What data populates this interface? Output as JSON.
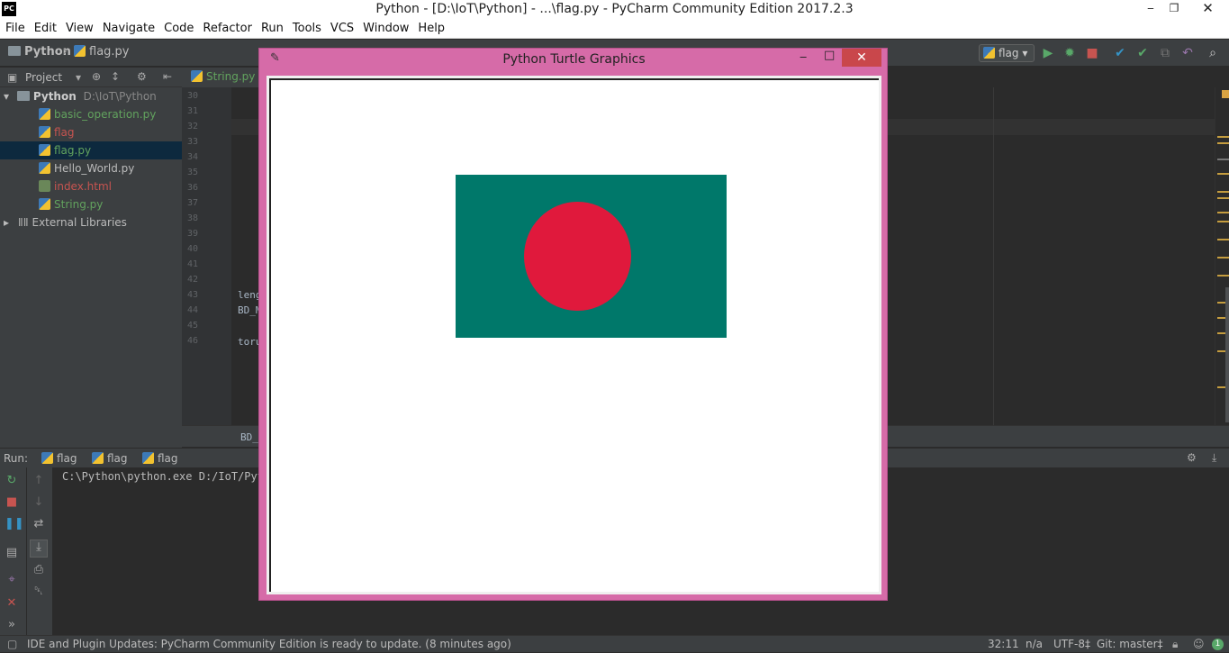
{
  "window": {
    "logo": "PC",
    "title": "Python - [D:\\IoT\\Python] - ...\\flag.py - PyCharm Community Edition 2017.2.3",
    "controls": [
      "minimize-icon",
      "maximize-icon",
      "close-icon"
    ]
  },
  "menu": [
    "File",
    "Edit",
    "View",
    "Navigate",
    "Code",
    "Refactor",
    "Run",
    "Tools",
    "VCS",
    "Window",
    "Help"
  ],
  "navbar": {
    "crumbs": [
      "Python",
      "flag.py"
    ],
    "run_config": "flag"
  },
  "project": {
    "header": "Project",
    "root_name": "Python",
    "root_path": "D:\\IoT\\Python",
    "files": [
      {
        "name": "basic_operation.py",
        "color": "#62a35e"
      },
      {
        "name": "flag",
        "color": "#c75450"
      },
      {
        "name": "flag.py",
        "color": "#62a35e"
      },
      {
        "name": "Hello_World.py",
        "color": "#bbbbbb"
      },
      {
        "name": "index.html",
        "color": "#c75450"
      },
      {
        "name": "String.py",
        "color": "#62a35e"
      }
    ],
    "external": "External Libraries"
  },
  "editor": {
    "tab": "String.py",
    "line_numbers": [
      "30",
      "31",
      "32",
      "33",
      "34",
      "35",
      "36",
      "37",
      "38",
      "39",
      "40",
      "41",
      "42",
      "43",
      "44",
      "45",
      "46"
    ],
    "code": [
      "leng",
      "BD_M",
      "",
      "toru"
    ],
    "breadcrumb": "BD_"
  },
  "run": {
    "label": "Run:",
    "tabs": [
      "flag",
      "flag",
      "flag"
    ],
    "console_line": "C:\\Python\\python.exe D:/IoT/Pyth"
  },
  "status": {
    "message": "IDE and Plugin Updates: PyCharm Community Edition is ready to update. (8 minutes ago)",
    "position": "32:11",
    "na": "n/a",
    "encoding": "UTF-8‡",
    "git": "Git: master‡",
    "badge": "1"
  },
  "turtle": {
    "title": "Python Turtle Graphics",
    "flag_green": "#00786a",
    "flag_red": "#e0193c"
  }
}
